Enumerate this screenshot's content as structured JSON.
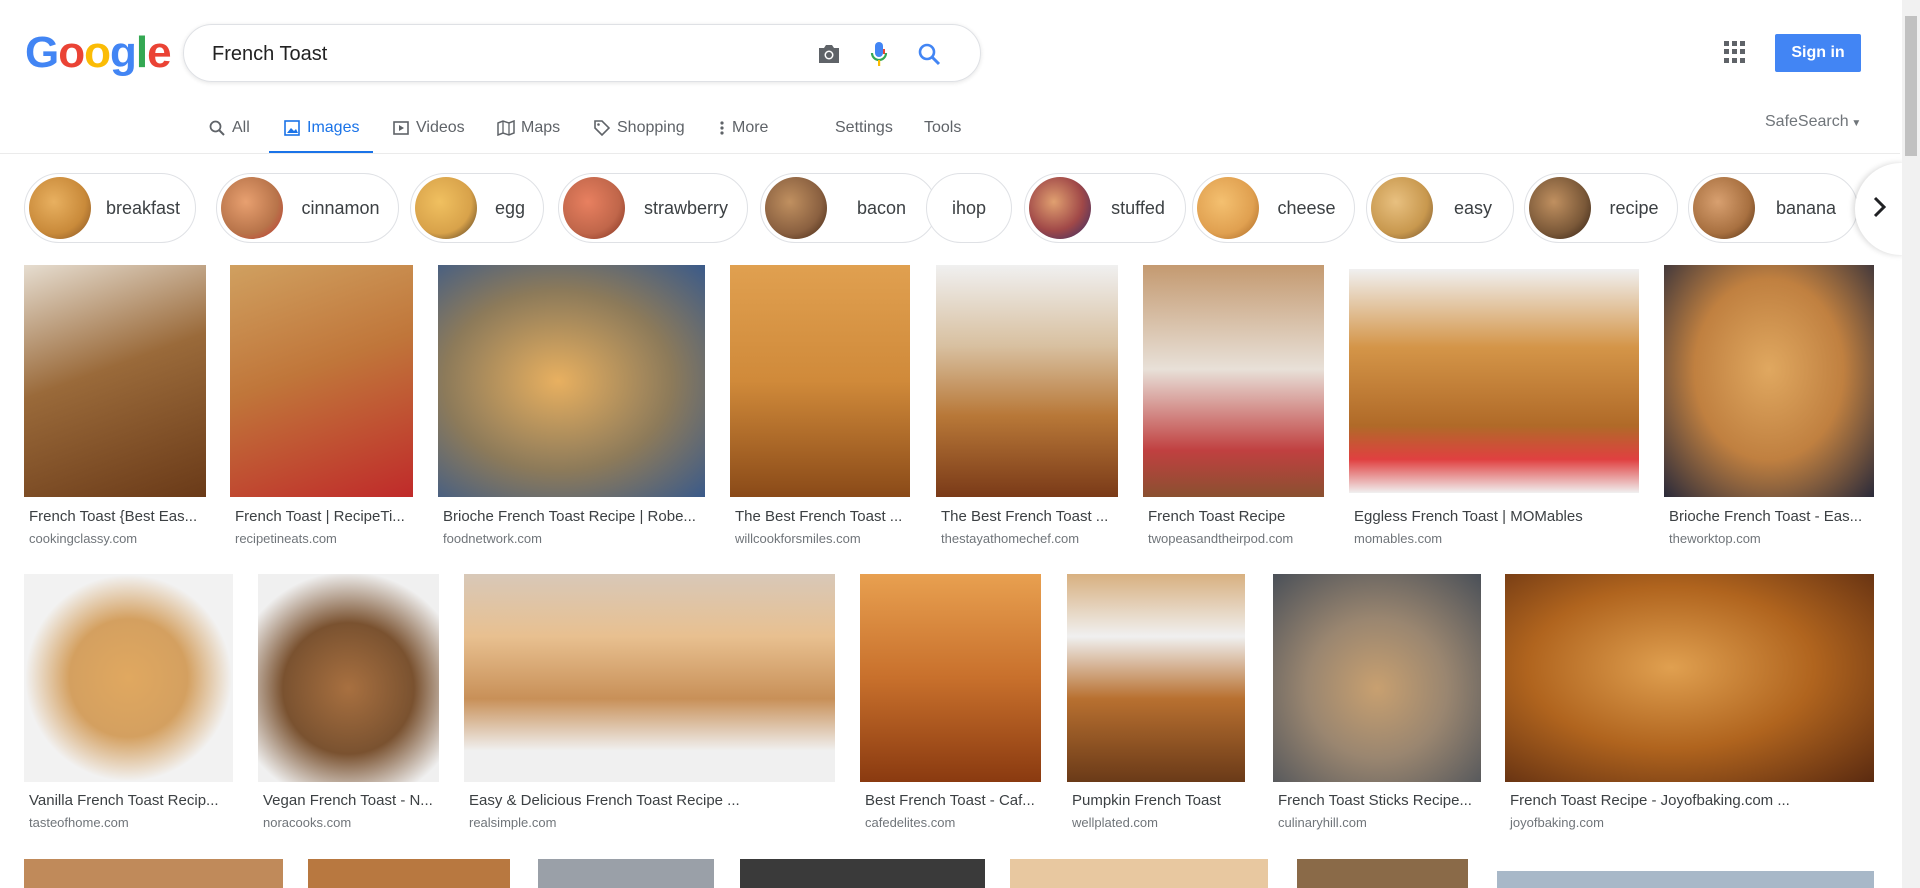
{
  "logo": {
    "letters": [
      "G",
      "o",
      "o",
      "g",
      "l",
      "e"
    ],
    "colors": [
      "#4285f4",
      "#ea4335",
      "#fbbc05",
      "#4285f4",
      "#34a853",
      "#ea4335"
    ]
  },
  "search": {
    "value": "French Toast"
  },
  "header": {
    "signin_label": "Sign in",
    "safesearch_label": "SafeSearch"
  },
  "tabs": [
    {
      "label": "All",
      "icon": "search-icon"
    },
    {
      "label": "Images",
      "icon": "image-icon"
    },
    {
      "label": "Videos",
      "icon": "video-icon"
    },
    {
      "label": "Maps",
      "icon": "map-icon"
    },
    {
      "label": "Shopping",
      "icon": "tag-icon"
    },
    {
      "label": "More",
      "icon": "more-vert-icon"
    },
    {
      "label": "Settings"
    },
    {
      "label": "Tools"
    }
  ],
  "chips": [
    {
      "label": "breakfast",
      "color": "#c98a3a"
    },
    {
      "label": "cinnamon",
      "color": "#b8744a"
    },
    {
      "label": "egg",
      "color": "#d8a24a"
    },
    {
      "label": "strawberry",
      "color": "#c0664a"
    },
    {
      "label": "bacon",
      "color": "#8a6040"
    },
    {
      "label": "ihop"
    },
    {
      "label": "stuffed",
      "color": "#a04848"
    },
    {
      "label": "cheese",
      "color": "#e0a050"
    },
    {
      "label": "easy",
      "color": "#c8984e"
    },
    {
      "label": "recipe",
      "color": "#7a5838"
    },
    {
      "label": "banana",
      "color": "#a87040"
    }
  ],
  "results_row1": [
    {
      "title": "French Toast {Best Eas...",
      "site": "cookingclassy.com",
      "color": "#9a6a3a"
    },
    {
      "title": "French Toast | RecipeTi...",
      "site": "recipetineats.com",
      "color": "#c0763a"
    },
    {
      "title": "Brioche French Toast Recipe | Robe...",
      "site": "foodnetwork.com",
      "color": "#8c7a5a"
    },
    {
      "title": "The Best French Toast ...",
      "site": "willcookforsmiles.com",
      "color": "#d08a3a"
    },
    {
      "title": "The Best French Toast ...",
      "site": "thestayathomechef.com",
      "color": "#b87838"
    },
    {
      "title": "French Toast Recipe",
      "site": "twopeasandtheirpod.com",
      "color": "#c49a70"
    },
    {
      "title": "Eggless French Toast | MOMables",
      "site": "momables.com",
      "color": "#d49548"
    },
    {
      "title": "Brioche French Toast - Eas...",
      "site": "theworktop.com",
      "color": "#c08040"
    }
  ],
  "results_row2": [
    {
      "title": "Vanilla French Toast Recip...",
      "site": "tasteofhome.com",
      "color": "#d4a060"
    },
    {
      "title": "Vegan French Toast - N...",
      "site": "noracooks.com",
      "color": "#7a5230"
    },
    {
      "title": "Easy & Delicious French Toast Recipe ...",
      "site": "realsimple.com",
      "color": "#c89058"
    },
    {
      "title": "Best French Toast - Caf...",
      "site": "cafedelites.com",
      "color": "#c8702c"
    },
    {
      "title": "Pumpkin French Toast",
      "site": "wellplated.com",
      "color": "#b87030"
    },
    {
      "title": "French Toast Sticks Recipe...",
      "site": "culinaryhill.com",
      "color": "#9a8670"
    },
    {
      "title": "French Toast Recipe - Joyofbaking.com ...",
      "site": "joyofbaking.com",
      "color": "#b0641e"
    }
  ],
  "row3_colors": [
    "#c08a5a",
    "#b87840",
    "#9aa0a8",
    "#3a3a3a",
    "#e8c8a0",
    "#8a6a48",
    "#a8b8c8"
  ]
}
